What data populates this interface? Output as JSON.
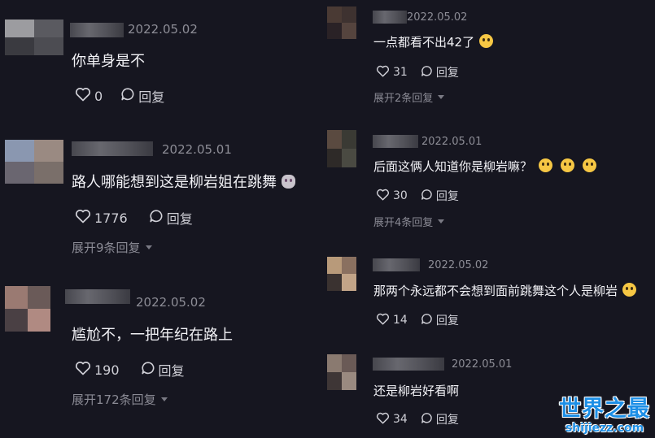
{
  "left_comments": [
    {
      "date": "2022.05.02",
      "text": "你单身是不",
      "likes": "0",
      "reply_label": "回复",
      "emoji": null,
      "expand": null
    },
    {
      "date": "2022.05.01",
      "text": "路人哪能想到这是柳岩姐在跳舞",
      "likes": "1776",
      "reply_label": "回复",
      "emoji": "cat-face-icon",
      "expand": "展开9条回复"
    },
    {
      "date": "2022.05.02",
      "text": "尴尬不，一把年纪在路上",
      "likes": "190",
      "reply_label": "回复",
      "emoji": null,
      "expand": "展开172条回复"
    }
  ],
  "right_comments": [
    {
      "date": "2022.05.02",
      "text": "一点都看不出42了",
      "likes": "31",
      "reply_label": "回复",
      "emoji": "laughing-emoji-icon",
      "expand": "展开2条回复"
    },
    {
      "date": "2022.05.01",
      "text": "后面这俩人知道你是柳岩嘛？",
      "likes": "30",
      "reply_label": "回复",
      "emoji": "pleading-emoji-icon",
      "expand": "展开4条回复"
    },
    {
      "date": "2022.05.02",
      "text": "那两个永远都不会想到面前跳舞这个人是柳岩",
      "likes": "14",
      "reply_label": "回复",
      "emoji": "thinking-emoji-icon",
      "expand": null
    },
    {
      "date": "2022.05.01",
      "text": "还是柳岩好看啊",
      "likes": "34",
      "reply_label": "回复",
      "emoji": null,
      "expand": null
    }
  ],
  "watermark": {
    "main": "世界之最",
    "sub": "shijiezz.com"
  },
  "colors": {
    "background": "#161620",
    "date": "#8d8d96",
    "text": "#f2f2f6",
    "action": "#cfcfd6",
    "watermark": "#1d8fe6"
  }
}
